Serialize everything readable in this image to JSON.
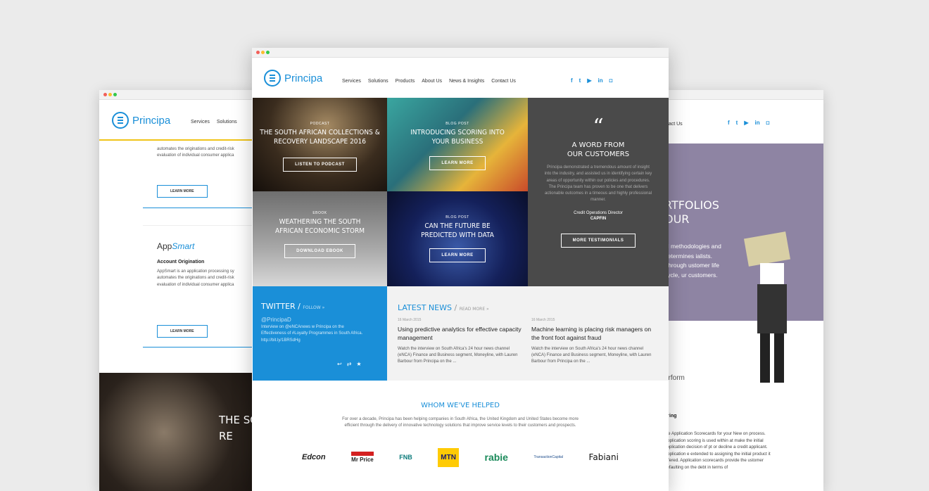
{
  "brand": {
    "name": "Principa",
    "color": "#1a8fd8"
  },
  "nav": [
    "Services",
    "Solutions",
    "Products",
    "About Us",
    "News & Insights",
    "Contact Us"
  ],
  "left": {
    "nav": [
      "Services",
      "Solutions"
    ],
    "card1": {
      "text": "automates the originations and credit-risk evaluation of individual consumer applica",
      "btn": "LEARN MORE"
    },
    "card2": {
      "brand_a": "App",
      "brand_b": "Smart",
      "title": "Account Origination",
      "text": "AppSmart is an application processing sy automates the originations and credit-risk evaluation of individual consumer applica",
      "btn": "LEARN MORE"
    },
    "hero": "THE SC RE"
  },
  "right": {
    "nav": "ntact Us",
    "headline": "RTFOLIOS\nOUR",
    "body": "al methodologies and determines ialists. Through ustomer life cycle, ur customers.",
    "frag1": "d",
    "frag2": "erform",
    "sub": "oring",
    "para": "ate Application Scorecards for your New on process. Application scoring is used within at make the initial application decision of pt or decline a credit applicant. Application e extended to assigning the initial product it offered. Application scorecards provide the ustomer defaulting on the debt in terms of"
  },
  "tiles": [
    {
      "tag": "PODCAST",
      "title": "THE SOUTH AFRICAN COLLECTIONS & RECOVERY LANDSCAPE 2016",
      "btn": "LISTEN TO PODCAST"
    },
    {
      "tag": "BLOG POST",
      "title": "INTRODUCING SCORING INTO YOUR BUSINESS",
      "btn": "LEARN MORE"
    },
    {
      "tag": "EBOOK",
      "title": "WEATHERING THE SOUTH AFRICAN ECONOMIC STORM",
      "btn": "DOWNLOAD EBOOK"
    },
    {
      "tag": "BLOG POST",
      "title": "CAN THE FUTURE BE PREDICTED WITH DATA",
      "btn": "LEARN MORE"
    }
  ],
  "testimonial": {
    "quote": "“",
    "heading": "A WORD FROM\nOUR CUSTOMERS",
    "text": "Principa demonstrated a tremendous amount of insight into the industry, and assisted us in identifying certain key areas of opportunity within our policies and procedures. The Principa team has proven to be one that delivers actionable outcomes in a timeous and highly professional manner.",
    "role": "Credit Operations Director",
    "company": "CAPFIN",
    "btn": "MORE TESTIMONIALS"
  },
  "twitter": {
    "title": "TWITTER /",
    "follow": "FOLLOW »",
    "handle": "@PrincipaD",
    "tweet": "Interview on @eNCAnews w Principa on the Effectiveness of #Loyalty Programmes in South Africa. http://bit.ly/1BRSdHg"
  },
  "news": {
    "title": "LATEST NEWS",
    "more": "READ MORE »",
    "items": [
      {
        "date": "16 March 2015",
        "title": "Using predictive analytics for effective capacity management",
        "text": "Watch the interview on South Africa's 24 hour news channel (eNCA) Finance and Business segment, Moneyline, with Lauren Barbour from Principa on the ..."
      },
      {
        "date": "16 March 2015",
        "title": "Machine learning is placing risk managers on the front foot against fraud",
        "text": "Watch the interview on South Africa's 24 hour news channel (eNCA) Finance and Business segment, Moneyline, with Lauren Barbour from Principa on the ..."
      }
    ]
  },
  "helped": {
    "title": "WHOM WE'VE HELPED",
    "text": "For over a decade, Principa has been helping companies in South Africa, the United Kingdom and United States become more efficient through the delivery of innovative technology solutions that improve service levels to their customers and prospects."
  },
  "logos": [
    "Edcon",
    "Mr Price",
    "FNB",
    "MTN",
    "rabie",
    "TransactionCapital",
    "Fabiani"
  ]
}
